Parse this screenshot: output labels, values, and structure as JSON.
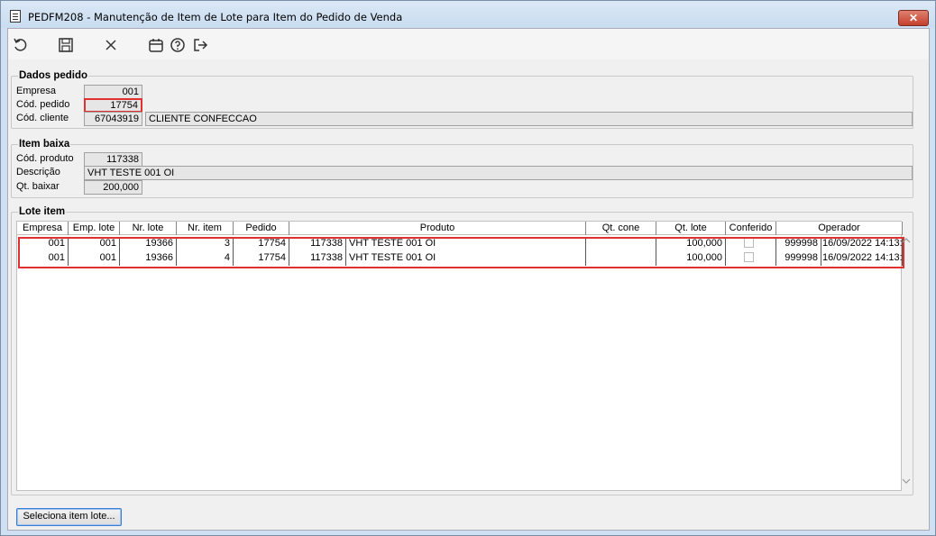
{
  "window": {
    "title": "PEDFM208 - Manutenção de Item de Lote para Item do Pedido de Venda",
    "close_label": "✕"
  },
  "toolbar": {
    "icons": [
      "undo-icon",
      "save-icon",
      "close-icon",
      "calendar-icon",
      "help-icon",
      "exit-icon"
    ]
  },
  "dados_pedido": {
    "title": "Dados pedido",
    "empresa_label": "Empresa",
    "empresa_value": "001",
    "cod_pedido_label": "Cód. pedido",
    "cod_pedido_value": "17754",
    "cod_cliente_label": "Cód. cliente",
    "cod_cliente_value": "67043919",
    "cliente_nome": "CLIENTE CONFECCAO"
  },
  "item_baixa": {
    "title": "Item baixa",
    "cod_produto_label": "Cód. produto",
    "cod_produto_value": "117338",
    "descricao_label": "Descrição",
    "descricao_value": "VHT TESTE 001 OI",
    "qt_baixar_label": "Qt. baixar",
    "qt_baixar_value": "200,000"
  },
  "lote_item": {
    "title": "Lote item",
    "columns": [
      "Empresa",
      "Emp. lote",
      "Nr. lote",
      "Nr. item",
      "Pedido",
      "Produto",
      "Qt. cone",
      "Qt. lote",
      "Conferido",
      "Operador"
    ],
    "rows": [
      {
        "empresa": "001",
        "emp_lote": "001",
        "nr_lote": "19366",
        "nr_item": "3",
        "pedido": "17754",
        "produto_cod": "117338",
        "produto_desc": "VHT TESTE 001 OI",
        "qt_cone": "",
        "qt_lote": "100,000",
        "conferido": false,
        "operador_cod": "999998",
        "operador_data": "16/09/2022 14:13:"
      },
      {
        "empresa": "001",
        "emp_lote": "001",
        "nr_lote": "19366",
        "nr_item": "4",
        "pedido": "17754",
        "produto_cod": "117338",
        "produto_desc": "VHT TESTE 001 OI",
        "qt_cone": "",
        "qt_lote": "100,000",
        "conferido": false,
        "operador_cod": "999998",
        "operador_data": "16/09/2022 14:13:"
      }
    ]
  },
  "actions": {
    "seleciona_label": "Seleciona item lote..."
  }
}
